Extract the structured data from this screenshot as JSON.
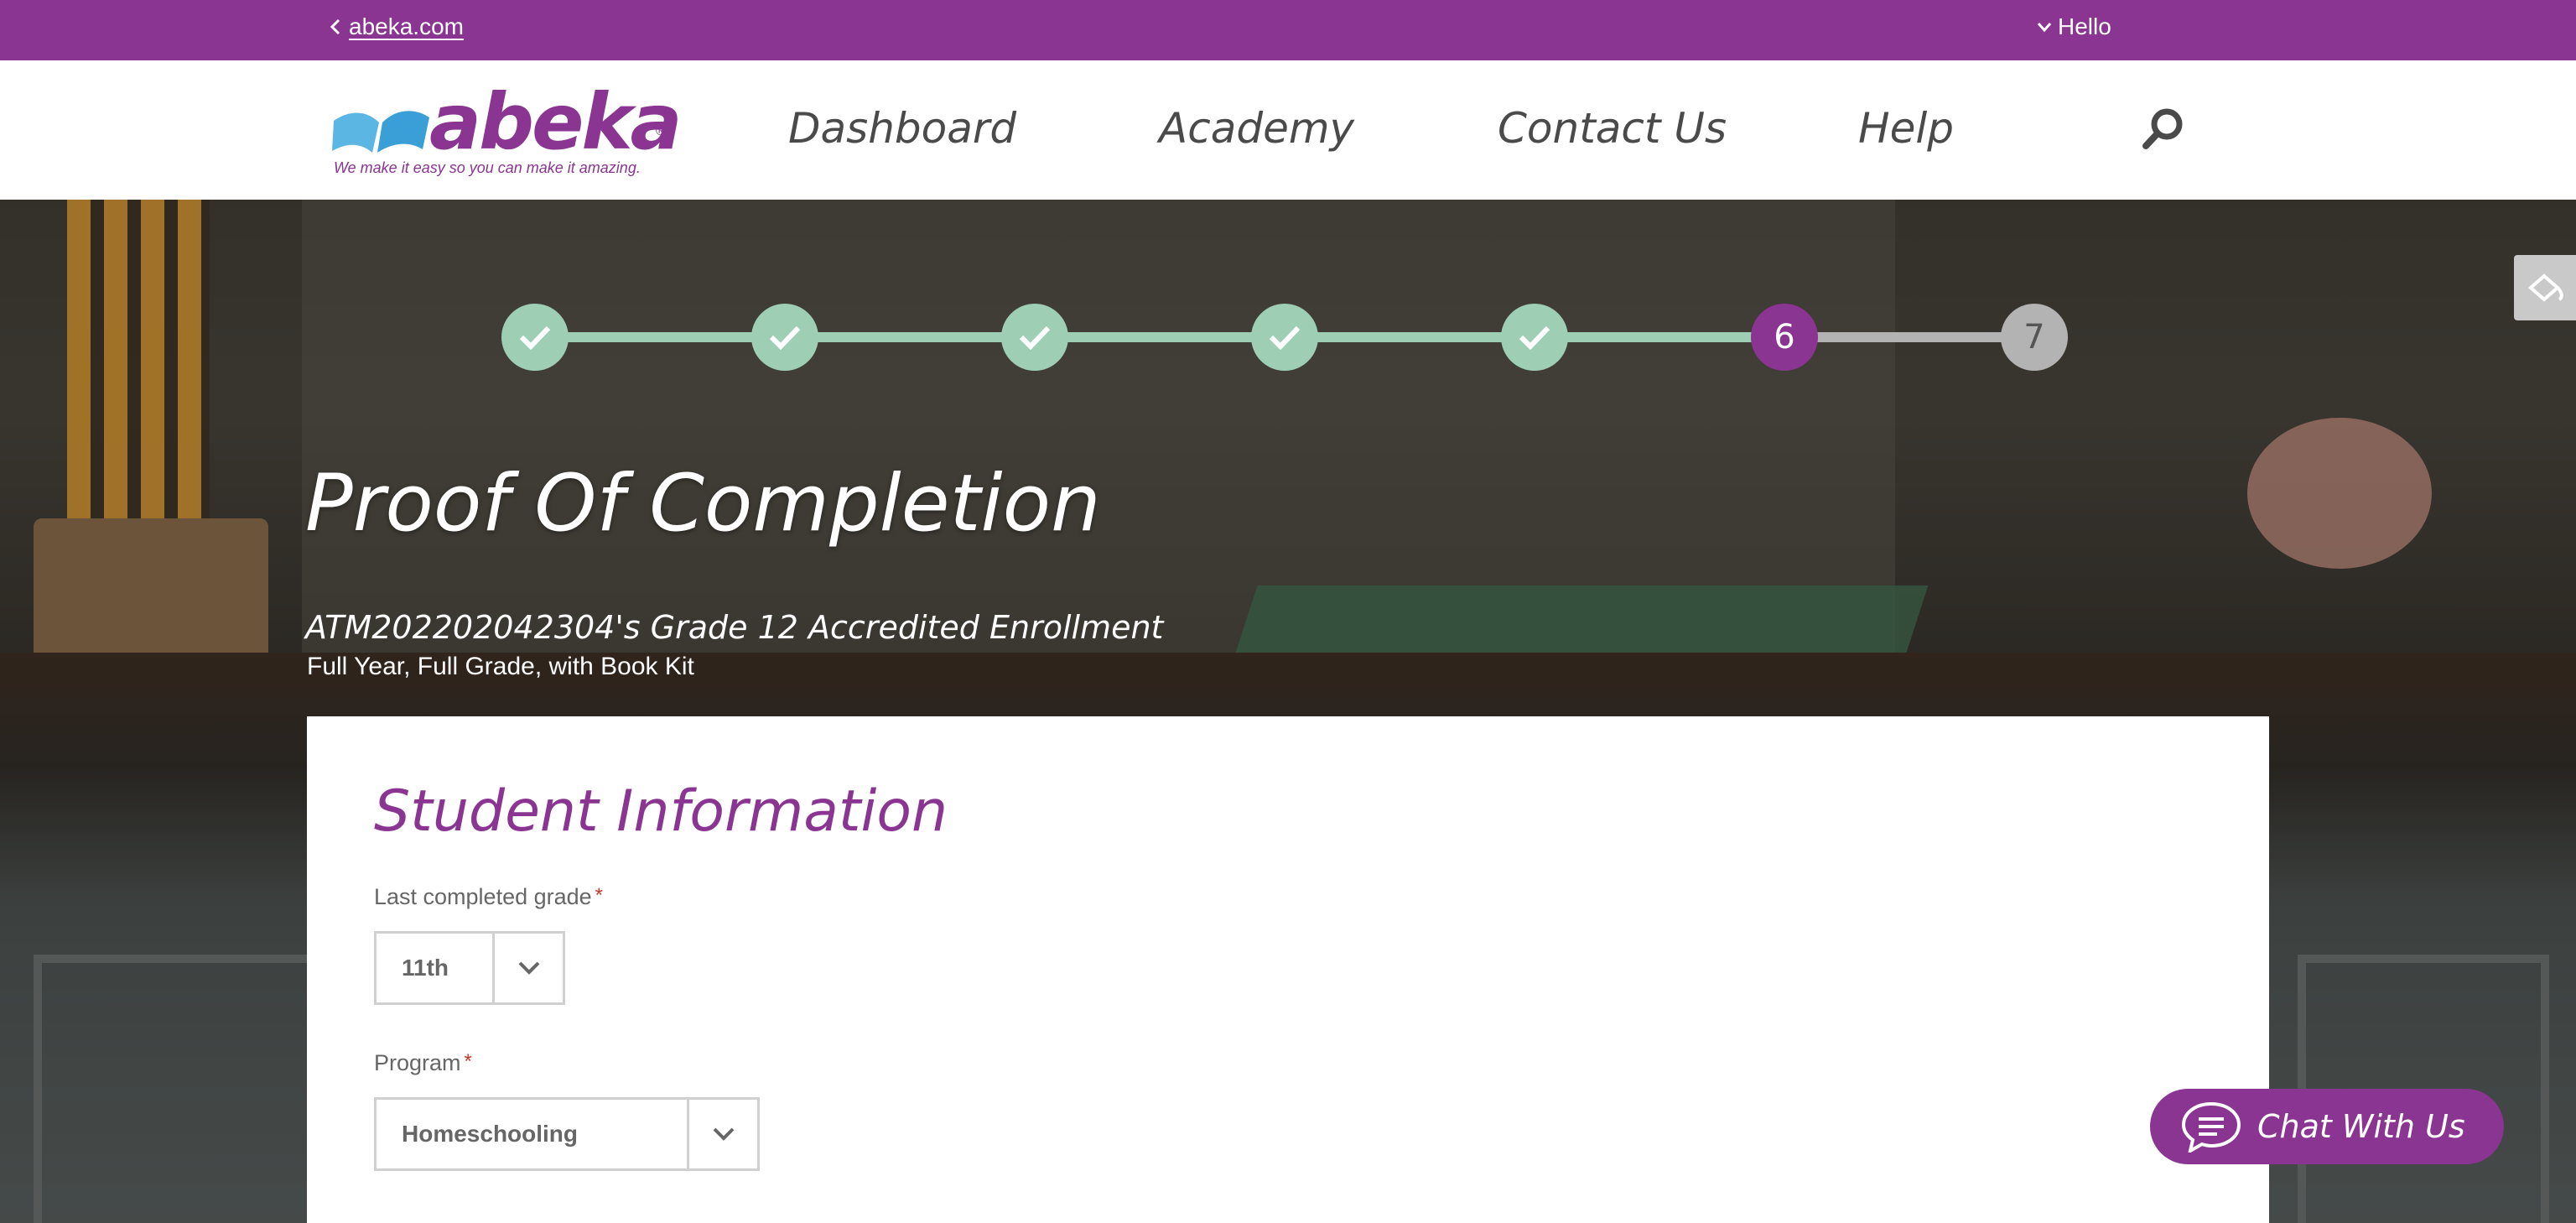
{
  "topbar": {
    "back_link": "abeka.com",
    "greeting": "Hello"
  },
  "header": {
    "logo_text": "abeka",
    "logo_tagline": "We make it easy so you can make it amazing.",
    "nav": [
      "Dashboard",
      "Academy",
      "Contact Us",
      "Help"
    ],
    "search_icon": "search-icon"
  },
  "stepper": {
    "steps": [
      {
        "label": "",
        "state": "done"
      },
      {
        "label": "",
        "state": "done"
      },
      {
        "label": "",
        "state": "done"
      },
      {
        "label": "",
        "state": "done"
      },
      {
        "label": "",
        "state": "done"
      },
      {
        "label": "6",
        "state": "current"
      },
      {
        "label": "7",
        "state": "todo"
      }
    ],
    "current_step": 6,
    "total_steps": 7
  },
  "hero": {
    "title": "Proof Of Completion",
    "enrollment_title": "ATM202202042304's Grade 12 Accredited Enrollment",
    "enrollment_subtitle": "Full Year, Full Grade, with Book Kit"
  },
  "form": {
    "section_title": "Student Information",
    "last_grade": {
      "label": "Last completed grade",
      "required_mark": "*",
      "value": "11th"
    },
    "program": {
      "label": "Program",
      "required_mark": "*",
      "value": "Homeschooling"
    }
  },
  "chat": {
    "label": "Chat With Us"
  },
  "colors": {
    "brand_purple": "#8a3591",
    "step_done": "#9ecfb5",
    "step_todo": "#b3b3b3"
  }
}
